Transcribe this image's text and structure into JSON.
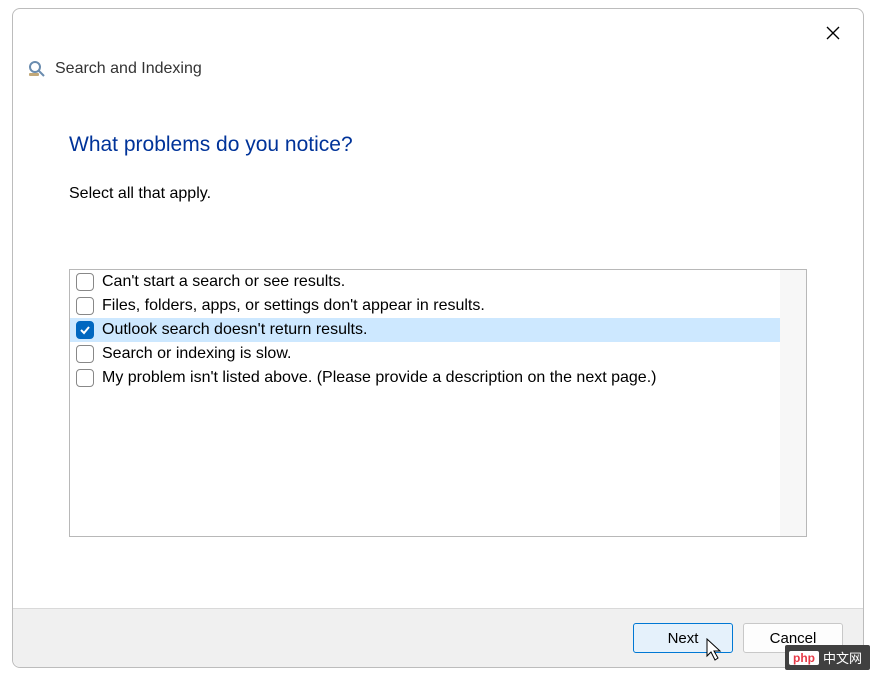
{
  "window": {
    "title": "Search and Indexing"
  },
  "main": {
    "question": "What problems do you notice?",
    "subtitle": "Select all that apply."
  },
  "options": [
    {
      "label": "Can't start a search or see results.",
      "checked": false
    },
    {
      "label": "Files, folders, apps, or settings don't appear in results.",
      "checked": false
    },
    {
      "label": "Outlook search doesn't return results.",
      "checked": true
    },
    {
      "label": "Search or indexing is slow.",
      "checked": false
    },
    {
      "label": "My problem isn't listed above. (Please provide a description on the next page.)",
      "checked": false
    }
  ],
  "footer": {
    "next_label": "Next",
    "cancel_label": "Cancel"
  },
  "watermark": {
    "brand": "php",
    "text": "中文网"
  }
}
